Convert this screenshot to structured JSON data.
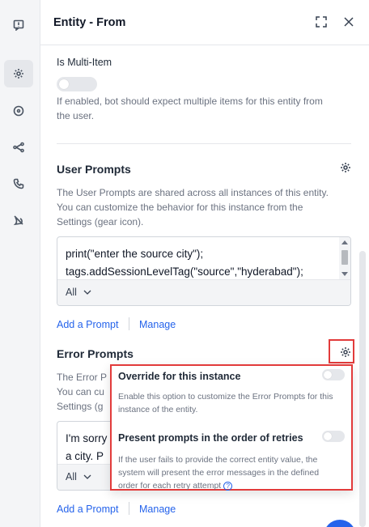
{
  "header": {
    "title": "Entity - From"
  },
  "multi_item": {
    "label": "Is Multi-Item",
    "description_line1": "If enabled, bot should expect multiple items for this entity from",
    "description_line2": "the user."
  },
  "user_prompts": {
    "title": "User Prompts",
    "description_line1": "The User Prompts are shared across all instances of this entity.",
    "description_line2": "You can customize the behavior for this instance from the",
    "description_line3": "Settings (gear icon).",
    "code_line1": "print(\"enter the source city\");",
    "code_line2": "tags.addSessionLevelTag(\"source\",\"hyderabad\");",
    "filter_value": "All",
    "add_link": "Add a Prompt",
    "manage_link": "Manage"
  },
  "error_prompts": {
    "title": "Error Prompts",
    "description_line1": "The Error P",
    "description_line2": "You can cu",
    "description_line3": "Settings (g",
    "code_line1": "I'm sorry",
    "code_line2": "a city. P",
    "filter_value": "All",
    "add_link": "Add a Prompt",
    "manage_link": "Manage"
  },
  "popup": {
    "override_title": "Override for this instance",
    "override_desc_line1": "Enable this option to customize the Error Prompts for this",
    "override_desc_line2": "instance of the entity.",
    "order_title": "Present prompts in the order of retries",
    "order_desc_line1": "If the user fails to provide the correct entity value, the",
    "order_desc_line2": "system will present the error messages in the defined",
    "order_desc_line3": "order for each retry attempt",
    "help_glyph": "?"
  },
  "colors": {
    "accent": "#2563eb",
    "highlight": "#e23b3b"
  },
  "icons": [
    "chat-alert-icon",
    "gear-icon",
    "target-icon",
    "flow-icon",
    "phone-icon",
    "bug-icon",
    "expand-icon",
    "close-icon",
    "chevron-down-icon",
    "help-icon"
  ]
}
